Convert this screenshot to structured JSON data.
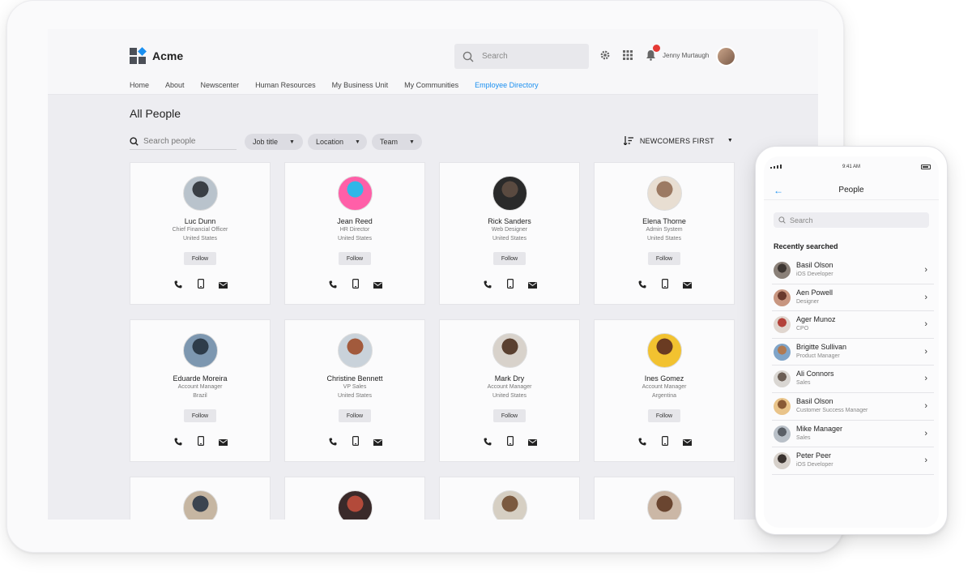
{
  "app": {
    "name": "Acme"
  },
  "header": {
    "search_placeholder": "Search",
    "user_name": "Jenny Murtaugh"
  },
  "nav": [
    {
      "label": "Home",
      "active": false
    },
    {
      "label": "About",
      "active": false
    },
    {
      "label": "Newscenter",
      "active": false
    },
    {
      "label": "Human Resources",
      "active": false
    },
    {
      "label": "My Business Unit",
      "active": false
    },
    {
      "label": "My Communities",
      "active": false
    },
    {
      "label": "Employee Directory",
      "active": true
    }
  ],
  "page": {
    "title": "All People"
  },
  "filters": {
    "search_placeholder": "Search people",
    "chips": [
      "Job title",
      "Location",
      "Team"
    ],
    "sort_label": "NEWCOMERS FIRST"
  },
  "follow_label": "Follow",
  "people": [
    {
      "name": "Luc Dunn",
      "role": "Chief Financial Officer",
      "country": "United States",
      "avatar": [
        "#b9c3cc",
        "#3a3f45"
      ]
    },
    {
      "name": "Jean Reed",
      "role": "HR Director",
      "country": "United States",
      "avatar": [
        "#ff5fa8",
        "#2fb7e8"
      ]
    },
    {
      "name": "Rick Sanders",
      "role": "Web Designer",
      "country": "United States",
      "avatar": [
        "#2a2a2a",
        "#5a4a40"
      ]
    },
    {
      "name": "Elena Thorne",
      "role": "Admin System",
      "country": "United States",
      "avatar": [
        "#e8ded2",
        "#9c7a63"
      ]
    },
    {
      "name": "Eduarde Moreira",
      "role": "Account Manager",
      "country": "Brazil",
      "avatar": [
        "#7d97b0",
        "#2e3c4a"
      ]
    },
    {
      "name": "Christine Bennett",
      "role": "VP Sales",
      "country": "United States",
      "avatar": [
        "#c9d2da",
        "#a25a3c"
      ]
    },
    {
      "name": "Mark Dry",
      "role": "Account Manager",
      "country": "United States",
      "avatar": [
        "#d8d2cb",
        "#5a4030"
      ]
    },
    {
      "name": "Ines Gomez",
      "role": "Account Manager",
      "country": "Argentina",
      "avatar": [
        "#f2c230",
        "#6a3b22"
      ]
    }
  ],
  "partial_avatars": [
    [
      "#c6b6a2",
      "#3b4450"
    ],
    [
      "#3a2a2a",
      "#b34a3a"
    ],
    [
      "#d6cfc3",
      "#7b5a40"
    ],
    [
      "#cbb7a6",
      "#6a4530"
    ]
  ],
  "phone": {
    "time": "9:41 AM",
    "title": "People",
    "search_placeholder": "Search",
    "section": "Recently searched",
    "contacts": [
      {
        "name": "Basil Olson",
        "role": "iOS Developer",
        "avatar": [
          "#8a8078",
          "#3d3632"
        ]
      },
      {
        "name": "Aen Powell",
        "role": "Designer",
        "avatar": [
          "#c89680",
          "#6a3a2e"
        ]
      },
      {
        "name": "Ager Munoz",
        "role": "CPO",
        "avatar": [
          "#e0d6cf",
          "#b3423a"
        ]
      },
      {
        "name": "Brigitte Sullivan",
        "role": "Product Manager",
        "avatar": [
          "#7fa4c8",
          "#b07a52"
        ]
      },
      {
        "name": "Ali Connors",
        "role": "Sales",
        "avatar": [
          "#d9d6d2",
          "#6b5e55"
        ]
      },
      {
        "name": "Basil Olson",
        "role": "Customer Success Manager",
        "avatar": [
          "#e9c48a",
          "#8a5a35"
        ]
      },
      {
        "name": "Mike Manager",
        "role": "Sales",
        "avatar": [
          "#b9c0c8",
          "#5a5f66"
        ]
      },
      {
        "name": "Peter Peer",
        "role": "iOS Developer",
        "avatar": [
          "#d6d0ca",
          "#3a3330"
        ]
      }
    ]
  },
  "colors": {
    "accent": "#1a8ff0",
    "notification": "#e53935"
  }
}
